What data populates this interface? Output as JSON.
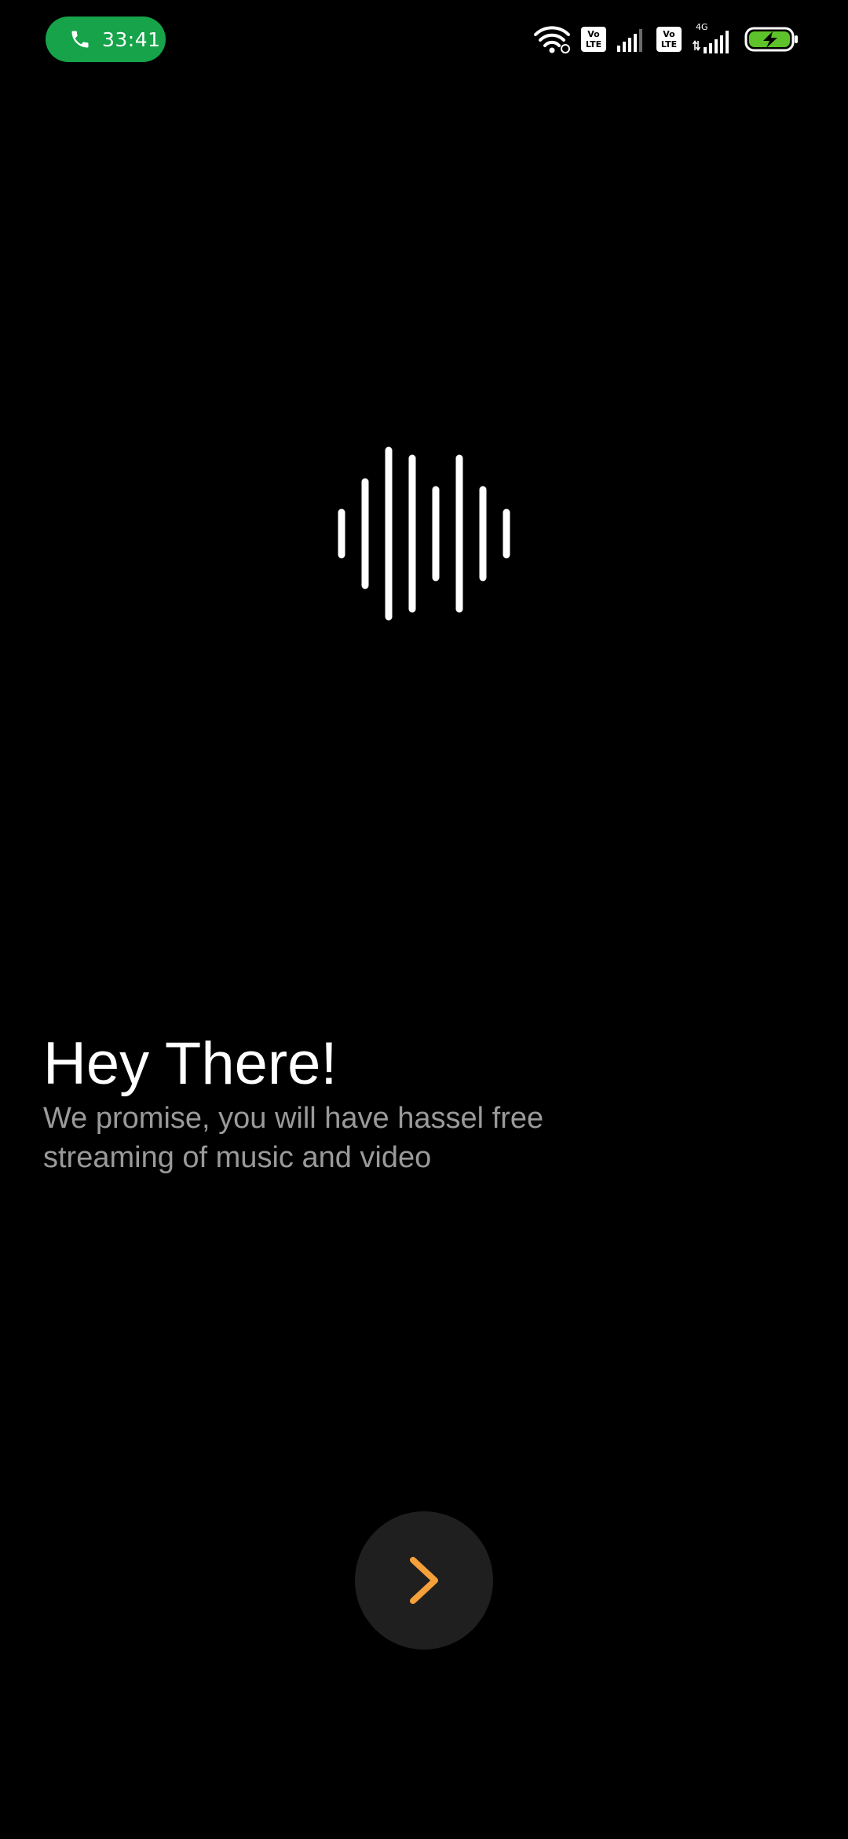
{
  "status_bar": {
    "call_time": "33:41",
    "volte_badge_1": [
      "Vo",
      "LTE"
    ],
    "volte_badge_2": [
      "Vo",
      "LTE"
    ],
    "network_type": "4G",
    "icons": [
      "phone-icon",
      "wifi-icon",
      "volte-icon",
      "signal-icon",
      "battery-charging-icon"
    ],
    "colors": {
      "call_pill": "#16a34a",
      "battery_fill": "#5ec32a"
    }
  },
  "logo": {
    "icon": "sound-wave-icon"
  },
  "onboarding": {
    "title": "Hey There!",
    "subtitle": "We promise, you will have hassel free streaming of music and video"
  },
  "next_button": {
    "icon": "chevron-right-icon",
    "accent_color": "#f5a03a"
  }
}
